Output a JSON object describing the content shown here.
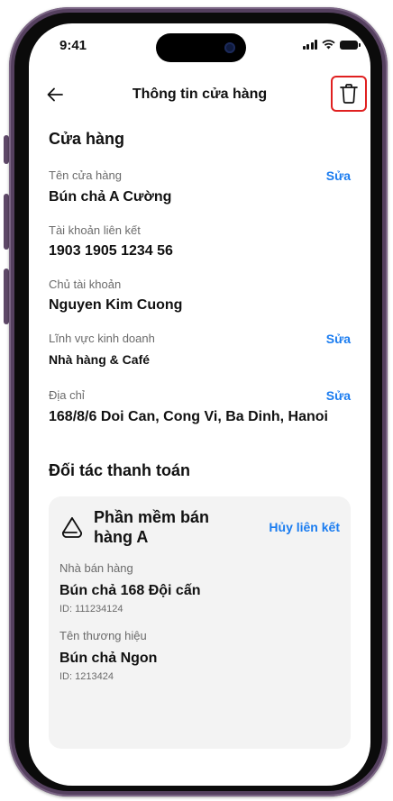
{
  "status_bar": {
    "time": "9:41"
  },
  "header": {
    "title": "Thông tin cửa hàng"
  },
  "store": {
    "section_title": "Cửa hàng",
    "fields": [
      {
        "label": "Tên cửa hàng",
        "value": "Bún chả A Cường",
        "edit": "Sửa"
      },
      {
        "label": "Tài khoản liên kết",
        "value": "1903 1905 1234 56"
      },
      {
        "label": "Chủ tài khoản",
        "value": "Nguyen Kim Cuong"
      },
      {
        "label": "Lĩnh vực kinh doanh",
        "value": "Nhà hàng & Café",
        "edit": "Sửa"
      },
      {
        "label": "Địa chỉ",
        "value": "168/8/6 Doi Can, Cong Vi, Ba Dinh, Hanoi",
        "edit": "Sửa"
      }
    ]
  },
  "partners": {
    "section_title": "Đối tác thanh toán",
    "card": {
      "name": "Phần mềm bán hàng A",
      "unlink_label": "Hủy liên kết",
      "vendor_label": "Nhà bán hàng",
      "vendor_value": "Bún chả 168 Đội cấn",
      "vendor_id": "ID: 111234124",
      "brand_label": "Tên thương hiệu",
      "brand_value": "Bún chả Ngon",
      "brand_id": "ID: 1213424"
    }
  },
  "icons": {
    "back": "arrow-left-icon",
    "delete": "trash-icon",
    "partner": "partner-logo-icon"
  },
  "colors": {
    "accent": "#1a7cf0",
    "highlight": "#e02020"
  }
}
